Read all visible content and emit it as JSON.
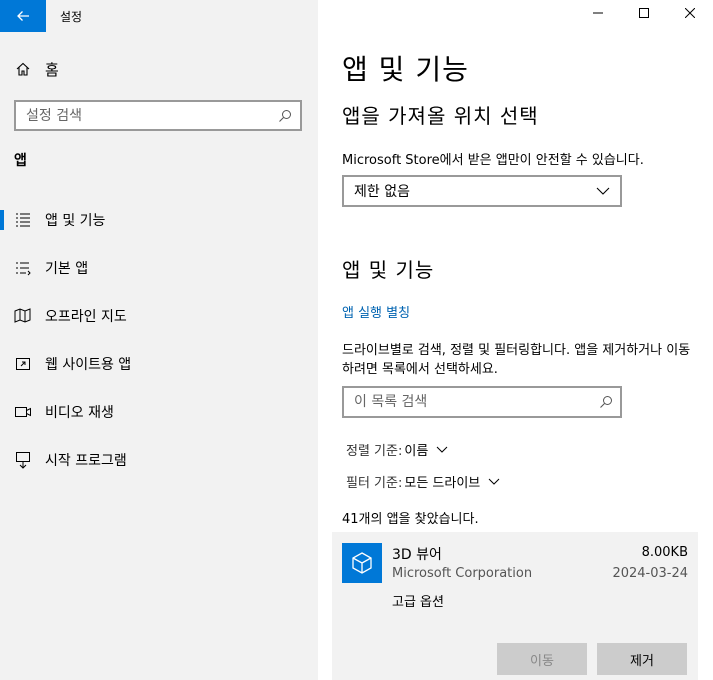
{
  "window": {
    "title": "설정",
    "controls": [
      "minimize",
      "maximize",
      "close"
    ]
  },
  "sidebar": {
    "home_label": "홈",
    "search_placeholder": "설정 검색",
    "section_title": "앱",
    "items": [
      {
        "label": "앱 및 기능",
        "icon": "apps-features-icon",
        "active": true
      },
      {
        "label": "기본 앱",
        "icon": "default-apps-icon",
        "active": false
      },
      {
        "label": "오프라인 지도",
        "icon": "offline-maps-icon",
        "active": false
      },
      {
        "label": "웹 사이트용 앱",
        "icon": "apps-for-websites-icon",
        "active": false
      },
      {
        "label": "비디오 재생",
        "icon": "video-playback-icon",
        "active": false
      },
      {
        "label": "시작 프로그램",
        "icon": "startup-icon",
        "active": false
      }
    ]
  },
  "main": {
    "title": "앱 및 기능",
    "install_section": {
      "heading": "앱을 가져올 위치 선택",
      "description": "Microsoft Store에서 받은 앱만이 안전할 수 있습니다.",
      "dropdown_value": "제한 없음"
    },
    "apps_section": {
      "heading": "앱 및 기능",
      "alias_link": "앱 실행 별칭",
      "description": "드라이브별로 검색, 정렬 및 필터링합니다. 앱을 제거하거나 이동하려면 목록에서 선택하세요.",
      "search_placeholder": "이 목록 검색",
      "sort_label": "정렬 기준:",
      "sort_value": "이름",
      "filter_label": "필터 기준:",
      "filter_value": "모든 드라이브",
      "count_text": "41개의 앱을 찾았습니다."
    },
    "selected_app": {
      "name": "3D 뷰어",
      "publisher": "Microsoft Corporation",
      "size": "8.00KB",
      "date": "2024-03-24",
      "advanced_options": "고급 옵션",
      "move_label": "이동",
      "remove_label": "제거"
    }
  },
  "colors": {
    "accent": "#0078d7",
    "link": "#0063b1",
    "sidebar_bg": "#f2f2f2"
  }
}
